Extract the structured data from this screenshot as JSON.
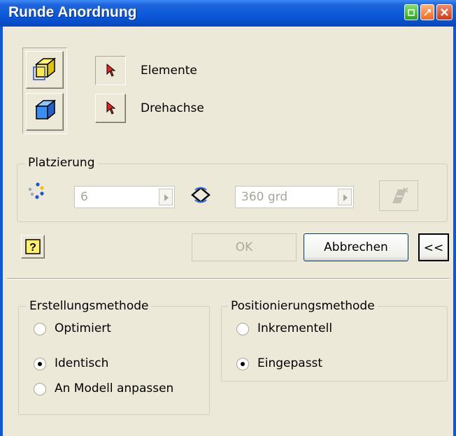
{
  "window": {
    "title": "Runde Anordnung"
  },
  "selectors": [
    {
      "label": "Elemente",
      "icon": "select-arrow-icon"
    },
    {
      "label": "Drehachse",
      "icon": "select-arrow-icon"
    }
  ],
  "placement": {
    "legend": "Platzierung",
    "count_value": "6",
    "angle_value": "360 grd"
  },
  "buttons": {
    "ok": "OK",
    "cancel": "Abbrechen",
    "more": "<<"
  },
  "creation_method": {
    "legend": "Erstellungsmethode",
    "options": [
      "Optimiert",
      "Identisch",
      "An Modell anpassen"
    ],
    "selected": "Identisch"
  },
  "positioning_method": {
    "legend": "Positionierungsmethode",
    "options": [
      "Inkrementell",
      "Eingepasst"
    ],
    "selected": "Eingepasst"
  },
  "colors": {
    "title_bar": "#0b58d8",
    "dialog_bg": "#ece9d8"
  }
}
